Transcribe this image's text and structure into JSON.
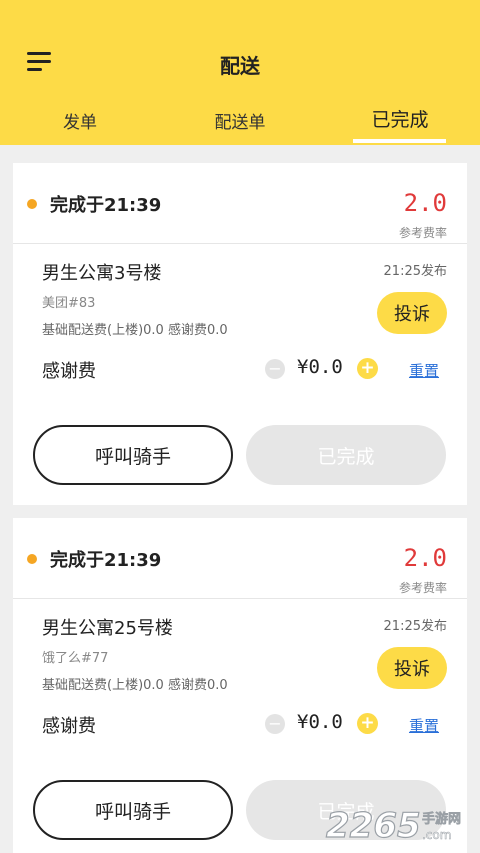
{
  "header": {
    "title": "配送",
    "tabs": [
      {
        "label": "发单"
      },
      {
        "label": "配送单"
      },
      {
        "label": "已完成"
      }
    ]
  },
  "orders": [
    {
      "completed_at": "完成于21:39",
      "rate_value": "2.0",
      "rate_label": "参考费率",
      "building": "男生公寓3号楼",
      "published_at": "21:25发布",
      "shop": "美团#83",
      "fees": "基础配送费(上楼)0.0 感谢费0.0",
      "complain_label": "投诉",
      "thanks_label": "感谢费",
      "minus": "−",
      "amount": "¥0.0",
      "plus": "+",
      "reset_label": "重置",
      "call_label": "呼叫骑手",
      "status_label": "已完成"
    },
    {
      "completed_at": "完成于21:39",
      "rate_value": "2.0",
      "rate_label": "参考费率",
      "building": "男生公寓25号楼",
      "published_at": "21:25发布",
      "shop": "饿了么#77",
      "fees": "基础配送费(上楼)0.0 感谢费0.0",
      "complain_label": "投诉",
      "thanks_label": "感谢费",
      "minus": "−",
      "amount": "¥0.0",
      "plus": "+",
      "reset_label": "重置",
      "call_label": "呼叫骑手",
      "status_label": "已完成"
    }
  ],
  "watermark": {
    "number": "2265",
    "suffix": ".com",
    "site": "手游网"
  },
  "colors": {
    "accent": "#fddb47",
    "rate": "#e03a3a",
    "link": "#2a6fd8",
    "dot": "#f5a623"
  }
}
